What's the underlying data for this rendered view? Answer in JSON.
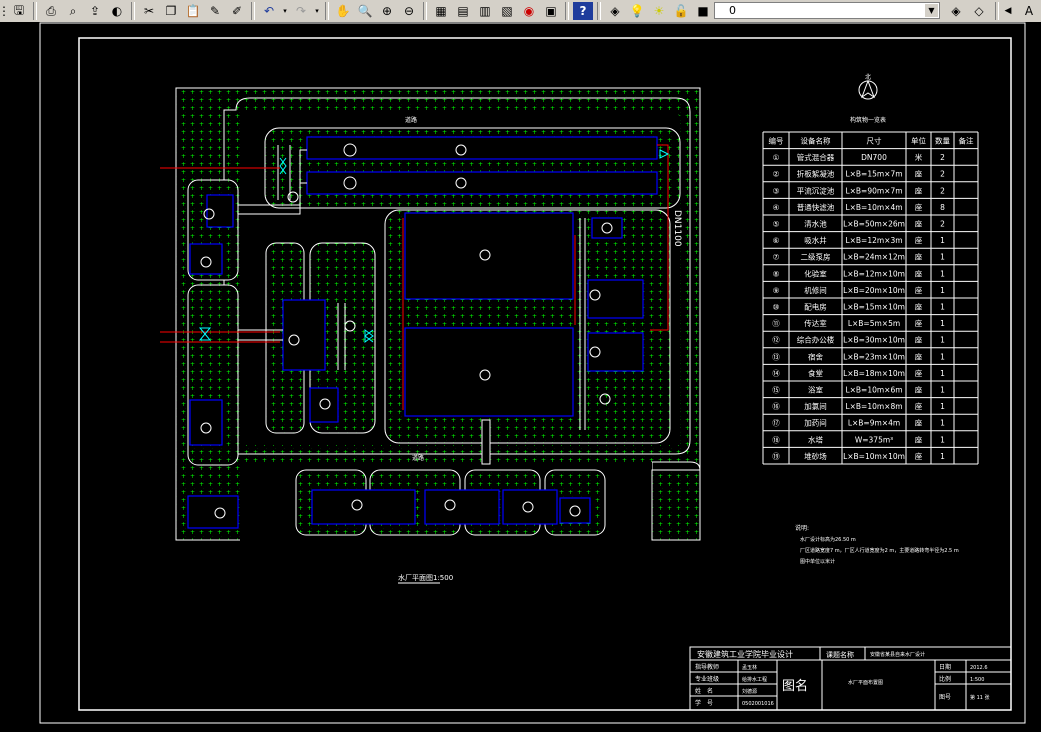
{
  "toolbar": {
    "buttons": [
      "new-icon",
      "open-icon",
      "save-icon",
      "plot-icon",
      "plot-preview-icon",
      "publish-icon",
      "3d-dwf-icon",
      "cut-icon",
      "copy-icon",
      "paste-icon",
      "match-properties-icon",
      "block-editor-icon",
      "undo-icon",
      "redo-icon",
      "pan-icon",
      "zoom-realtime-icon",
      "zoom-window-icon",
      "zoom-previous-icon",
      "properties-icon",
      "design-center-icon",
      "tool-palettes-icon",
      "sheet-set-icon",
      "markup-icon",
      "quickcalc-icon",
      "help-icon"
    ],
    "layer_value": "0"
  },
  "table": {
    "title": "构筑物一览表",
    "headers": [
      "编号",
      "设备名称",
      "尺寸",
      "单位",
      "数量",
      "备注"
    ],
    "rows": [
      [
        "①",
        "管式混合器",
        "DN700",
        "米",
        "2",
        ""
      ],
      [
        "②",
        "折板絮凝池",
        "L×B=15m×7m",
        "座",
        "2",
        ""
      ],
      [
        "③",
        "平流沉淀池",
        "L×B=90m×7m",
        "座",
        "2",
        ""
      ],
      [
        "④",
        "普通快滤池",
        "L×B=10m×4m",
        "座",
        "8",
        ""
      ],
      [
        "⑤",
        "清水池",
        "L×B=50m×26m",
        "座",
        "2",
        ""
      ],
      [
        "⑥",
        "吸水井",
        "L×B=12m×3m",
        "座",
        "1",
        ""
      ],
      [
        "⑦",
        "二级泵房",
        "L×B=24m×12m",
        "座",
        "1",
        ""
      ],
      [
        "⑧",
        "化验室",
        "L×B=12m×10m",
        "座",
        "1",
        ""
      ],
      [
        "⑨",
        "机修间",
        "L×B=20m×10m",
        "座",
        "1",
        ""
      ],
      [
        "⑩",
        "配电房",
        "L×B=15m×10m",
        "座",
        "1",
        ""
      ],
      [
        "⑪",
        "传达室",
        "L×B=5m×5m",
        "座",
        "1",
        ""
      ],
      [
        "⑫",
        "综合办公楼",
        "L×B=30m×10m",
        "座",
        "1",
        ""
      ],
      [
        "⑬",
        "宿舍",
        "L×B=23m×10m",
        "座",
        "1",
        ""
      ],
      [
        "⑭",
        "食堂",
        "L×B=18m×10m",
        "座",
        "1",
        ""
      ],
      [
        "⑮",
        "浴室",
        "L×B=10m×6m",
        "座",
        "1",
        ""
      ],
      [
        "⑯",
        "加氯间",
        "L×B=10m×8m",
        "座",
        "1",
        ""
      ],
      [
        "⑰",
        "加药间",
        "L×B=9m×4m",
        "座",
        "1",
        ""
      ],
      [
        "⑱",
        "水塔",
        "W=375m³",
        "座",
        "1",
        ""
      ],
      [
        "⑲",
        "堆砂场",
        "L×B=10m×10m",
        "座",
        "1",
        ""
      ]
    ]
  },
  "plan": {
    "caption": "水厂平面图1:500",
    "pipe_label": "DN1100",
    "road_label": "道路",
    "north": "北"
  },
  "notes": {
    "title": "说明:",
    "lines": [
      "水厂设计标高为26.50 m",
      "厂区道路宽度7 m，厂区人行道宽度为2 m，主要道路转弯半径为2.5 m",
      "图中单位以米计"
    ]
  },
  "title_block": {
    "school": "安徽建筑工业学院毕业设计",
    "project_label": "课题名称",
    "project_name": "安徽省某县自来水厂设计",
    "left_labels": [
      "指导教师",
      "专业班级",
      "姓　名",
      "学　号"
    ],
    "left_values": [
      "孟玉林",
      "给排水工程",
      "刘德源",
      "0502001016"
    ],
    "drawing_label": "图名",
    "drawing_name": "水厂平面布置图",
    "right_labels": [
      "日期",
      "比例",
      "图号"
    ],
    "right_values": [
      "2012.6",
      "1:500",
      "第 11 张"
    ]
  },
  "colors": {
    "background": "#000000",
    "green_hatch": "#00ff00",
    "white_lines": "#ffffff",
    "blue_lines": "#0000ff",
    "red_lines": "#ff0000",
    "cyan": "#00ffff",
    "toolbar": "#d4d0c8"
  }
}
